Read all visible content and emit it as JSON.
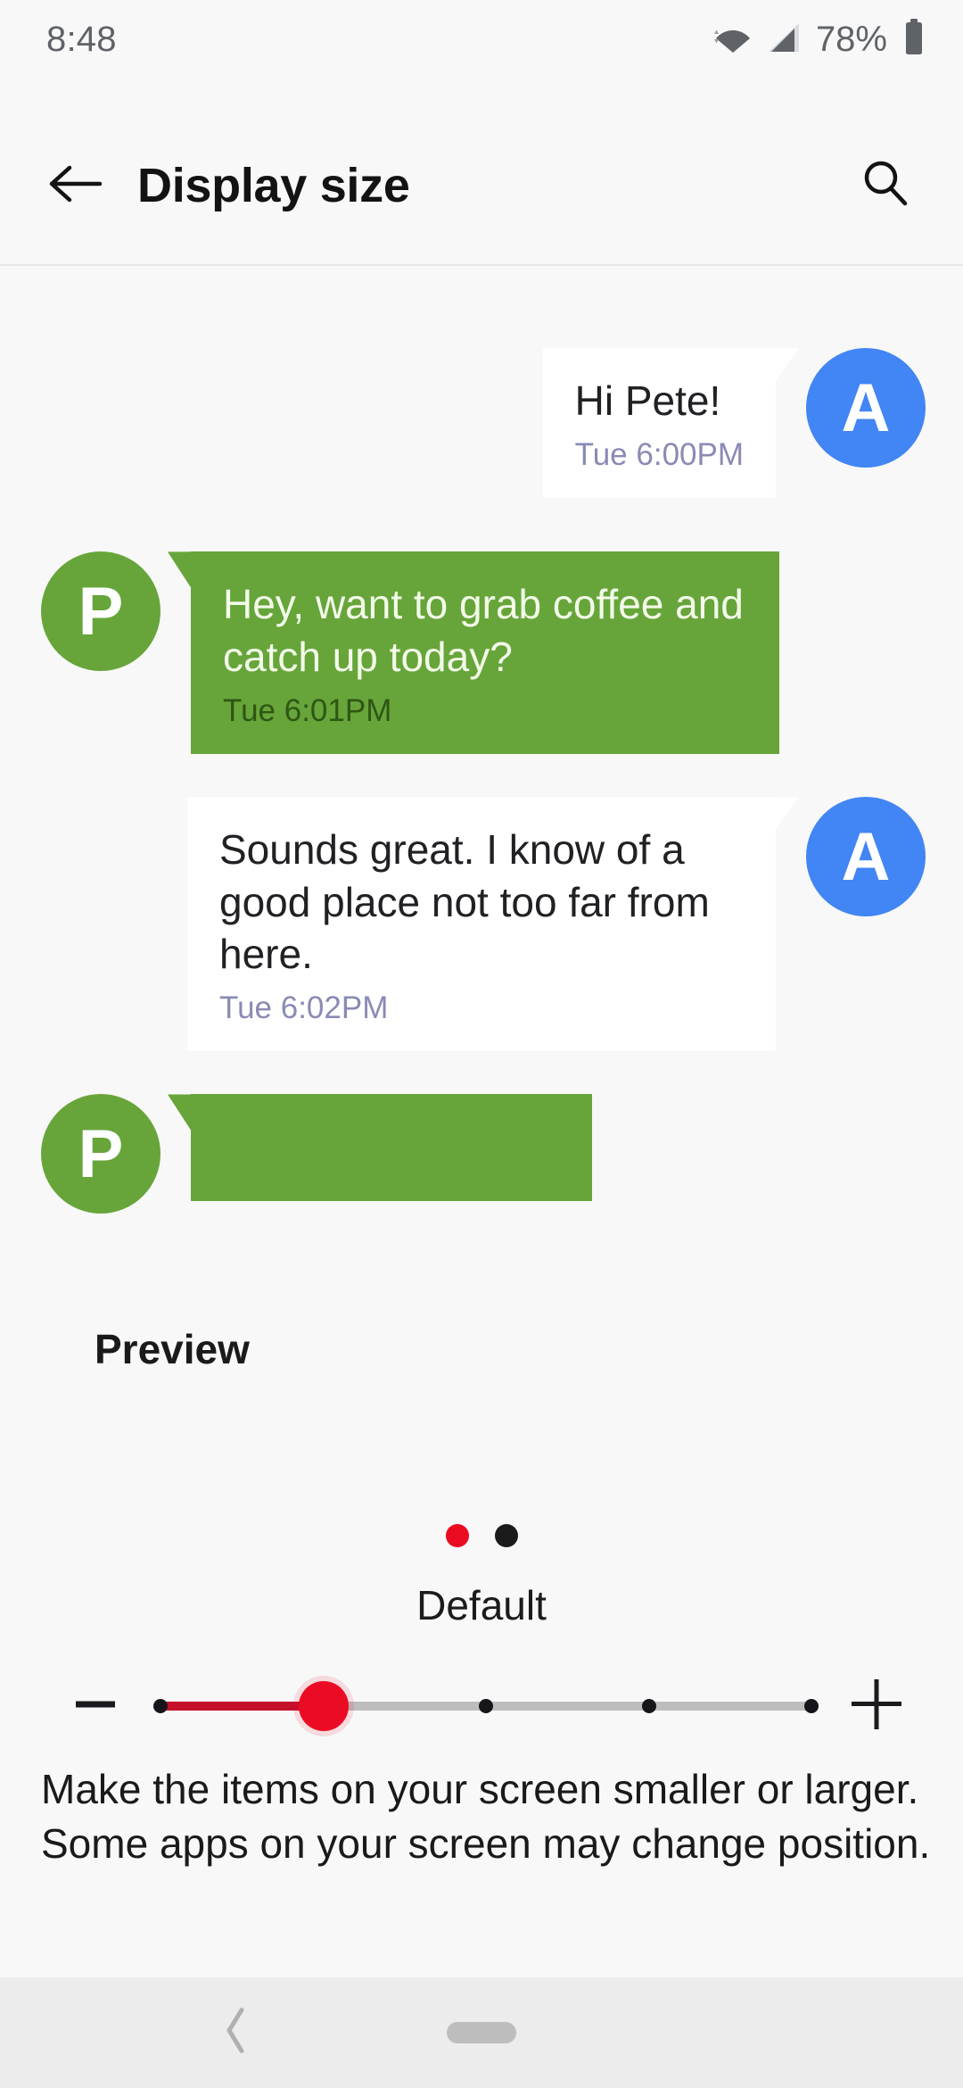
{
  "status_bar": {
    "time": "8:48",
    "battery_percent": "78%",
    "wifi_icon": "wifi-icon",
    "signal_icon": "signal-icon",
    "battery_icon": "battery-icon"
  },
  "app_bar": {
    "back_icon": "back-arrow-icon",
    "title": "Display size",
    "search_icon": "search-icon"
  },
  "preview": {
    "label": "Preview",
    "messages": [
      {
        "side": "right",
        "avatar_letter": "A",
        "avatar_color": "#4285f4",
        "text": "Hi Pete!",
        "time": "Tue 6:00PM",
        "bubble_color": "#ffffff"
      },
      {
        "side": "left",
        "avatar_letter": "P",
        "avatar_color": "#67a53a",
        "text": "Hey, want to grab coffee and catch up today?",
        "time": "Tue 6:01PM",
        "bubble_color": "#67a53a"
      },
      {
        "side": "right",
        "avatar_letter": "A",
        "avatar_color": "#4285f4",
        "text": "Sounds great. I know of a good place not too far from here.",
        "time": "Tue 6:02PM",
        "bubble_color": "#ffffff"
      },
      {
        "side": "left",
        "avatar_letter": "P",
        "avatar_color": "#67a53a",
        "text": "",
        "time": "",
        "bubble_color": "#67a53a"
      }
    ]
  },
  "size_control": {
    "dots": [
      {
        "state": "active",
        "color": "#ea0b20"
      },
      {
        "state": "inactive",
        "color": "#1b1b1b"
      }
    ],
    "current_value_label": "Default",
    "decrease_label": "−",
    "increase_label": "+",
    "steps": 5,
    "current_step": 2,
    "active_track_color": "#c5102a",
    "thumb_color": "#ec0b24",
    "track_color": "#bdbdbd"
  },
  "description": "Make the items on your screen smaller or larger. Some apps on your screen may change position.",
  "nav_bar": {
    "back_icon": "nav-back-chevron-icon",
    "home_icon": "nav-home-pill-icon"
  }
}
